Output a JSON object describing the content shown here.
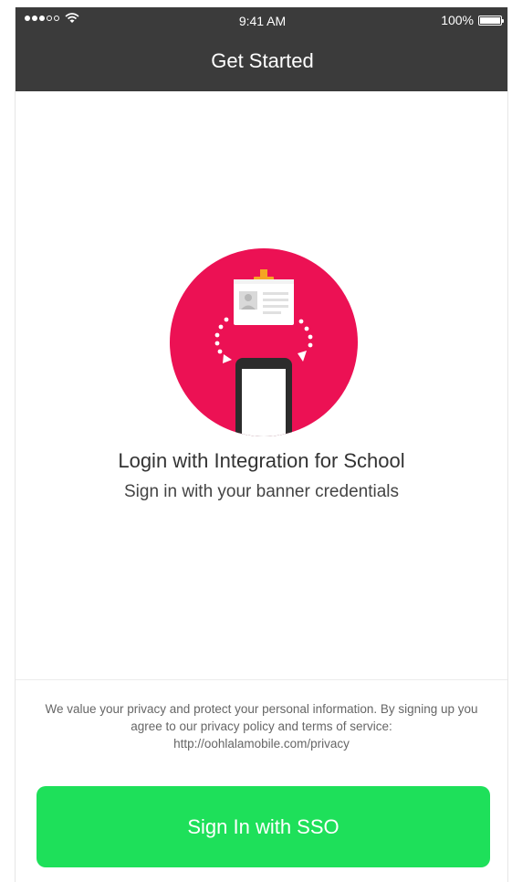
{
  "status_bar": {
    "time": "9:41 AM",
    "battery_percent": "100%",
    "signal_icon": "signal-dots-icon",
    "wifi_icon": "wifi-icon",
    "battery_icon": "battery-icon"
  },
  "header": {
    "title": "Get Started"
  },
  "main": {
    "illustration_icon": "id-card-to-phone-icon",
    "headline": "Login with Integration for School",
    "subline": "Sign in with your banner credentials"
  },
  "footer": {
    "privacy_text": "We value your privacy and protect your personal information. By signing up you agree to our privacy policy and terms of service: http://oohlalamobile.com/privacy",
    "sso_button_label": "Sign In with SSO"
  },
  "colors": {
    "header_bg": "#3b3b3b",
    "accent_circle": "#ec1154",
    "button_green": "#1ee05a",
    "text_dark": "#333333"
  }
}
